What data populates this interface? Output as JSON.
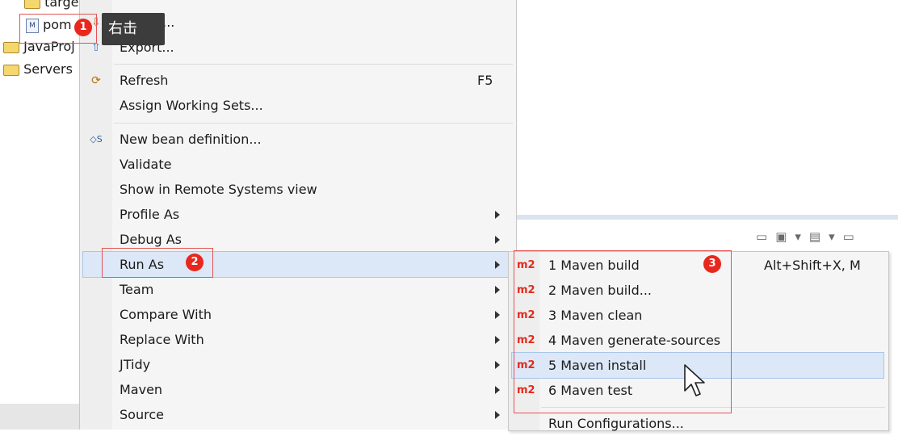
{
  "tree": {
    "items": [
      {
        "label": "targe",
        "icon": "folder-icon"
      },
      {
        "label": "pom",
        "icon": "maven-xml-file-icon"
      },
      {
        "label": "JavaProj",
        "icon": "java-project-icon"
      },
      {
        "label": "Servers",
        "icon": "folder-icon"
      }
    ]
  },
  "tooltip": "右击",
  "context_menu": {
    "items": [
      {
        "label": "Import..."
      },
      {
        "label": "Export..."
      },
      {
        "label": "Refresh",
        "accelerator": "F5",
        "icon": "refresh-icon"
      },
      {
        "label": "Assign Working Sets..."
      },
      {
        "label": "New bean definition...",
        "icon": "bean-definition-icon"
      },
      {
        "label": "Validate"
      },
      {
        "label": "Show in Remote Systems view"
      },
      {
        "label": "Profile As",
        "submenu": true
      },
      {
        "label": "Debug As",
        "submenu": true
      },
      {
        "label": "Run As",
        "submenu": true,
        "highlighted": true
      },
      {
        "label": "Team",
        "submenu": true
      },
      {
        "label": "Compare With",
        "submenu": true
      },
      {
        "label": "Replace With",
        "submenu": true
      },
      {
        "label": "JTidy",
        "submenu": true
      },
      {
        "label": "Maven",
        "submenu": true
      },
      {
        "label": "Source",
        "submenu": true
      }
    ]
  },
  "run_as_submenu": {
    "items": [
      {
        "badge": "m2",
        "label": "1 Maven build",
        "accelerator": "Alt+Shift+X, M"
      },
      {
        "badge": "m2",
        "label": "2 Maven build..."
      },
      {
        "badge": "m2",
        "label": "3 Maven clean"
      },
      {
        "badge": "m2",
        "label": "4 Maven generate-sources"
      },
      {
        "badge": "m2",
        "label": "5 Maven install",
        "highlighted": true
      },
      {
        "badge": "m2",
        "label": "6 Maven test"
      },
      {
        "label": "Run Configurations..."
      }
    ]
  },
  "annotations": {
    "step1": "1",
    "step2": "2",
    "step3": "3"
  },
  "colors": {
    "annotation_red": "#e8281e",
    "highlight": "#dce8f7",
    "maven_badge": "#e42a1c"
  }
}
